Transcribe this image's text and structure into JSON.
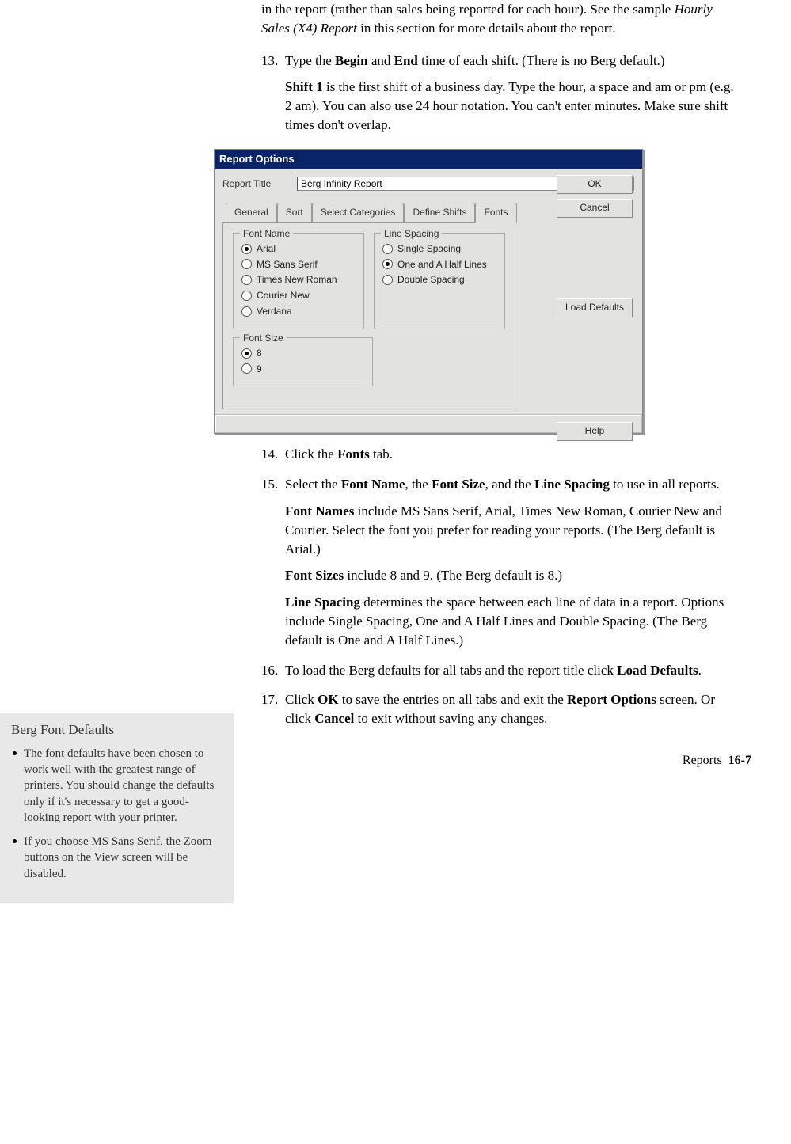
{
  "intro": {
    "cont_pre": "in the report (rather than sales being reported for each hour). See the sample ",
    "cont_em": "Hourly Sales (X4) Report",
    "cont_post": " in this section for more details about the report."
  },
  "steps": {
    "s13": {
      "num": "13.",
      "t1a": "Type the ",
      "t1b": "Begin",
      "t1c": " and ",
      "t1d": "End",
      "t1e": " time of each shift. (There is no Berg default.)",
      "p2a": "Shift 1",
      "p2b": " is the first shift of a business day. Type the hour, a space and am or pm (e.g. 2 am). You can also use 24 hour notation. You can't enter minutes. Make sure shift times don't overlap."
    },
    "s14": {
      "num": "14.",
      "a": "Click the ",
      "b": "Fonts",
      "c": " tab."
    },
    "s15": {
      "num": "15.",
      "l1a": "Select the ",
      "l1b": "Font Name",
      "l1c": ", the ",
      "l1d": "Font Size",
      "l1e": ", and the ",
      "l1f": "Line Spacing",
      "l1g": " to use in all reports.",
      "p2a": "Font Names",
      "p2b": " include MS Sans Serif, Arial, Times New Roman, Courier New and Courier. Select the font you prefer for reading your reports. (The Berg default is Arial.)",
      "p3a": "Font Sizes",
      "p3b": " include 8 and 9. (The Berg default is 8.)",
      "p4a": "Line Spacing",
      "p4b": " determines the space between each line of data in a report. Options include Single Spacing, One and A Half Lines and Double Spacing. (The Berg default is One and A Half Lines.)"
    },
    "s16": {
      "num": "16.",
      "a": "To load the Berg defaults for all tabs and the report title click ",
      "b": "Load Defaults",
      "c": "."
    },
    "s17": {
      "num": "17.",
      "a": "Click ",
      "b": "OK",
      "c": " to save the entries on all tabs and exit the ",
      "d": "Report Options",
      "e": " screen. Or click ",
      "f": "Cancel",
      "g": " to exit without saving any changes."
    }
  },
  "dialog": {
    "title": "Report Options",
    "reportTitleLabel": "Report Title",
    "reportTitleValue": "Berg Infinity Report",
    "tabs": {
      "general": "General",
      "sort": "Sort",
      "selectcat": "Select Categories",
      "defshifts": "Define Shifts",
      "fonts": "Fonts"
    },
    "fontName": {
      "legend": "Font Name",
      "arial": "Arial",
      "mssans": "MS Sans Serif",
      "times": "Times New Roman",
      "courier": "Courier New",
      "verdana": "Verdana"
    },
    "lineSpacing": {
      "legend": "Line Spacing",
      "single": "Single Spacing",
      "onehalf": "One and A Half Lines",
      "double": "Double Spacing"
    },
    "fontSize": {
      "legend": "Font Size",
      "s8": "8",
      "s9": "9"
    },
    "buttons": {
      "ok": "OK",
      "cancel": "Cancel",
      "load": "Load Defaults",
      "help": "Help"
    }
  },
  "sidebar": {
    "title": "Berg Font Defaults",
    "b1": "The font defaults have been chosen to work well with the greatest range of printers. You should change the defaults only if it's necessary to get a good-looking report with your printer.",
    "b2": "If you choose MS Sans Serif, the Zoom buttons on the View screen will be disabled."
  },
  "footer": {
    "label": "Reports",
    "page": "16-7"
  }
}
